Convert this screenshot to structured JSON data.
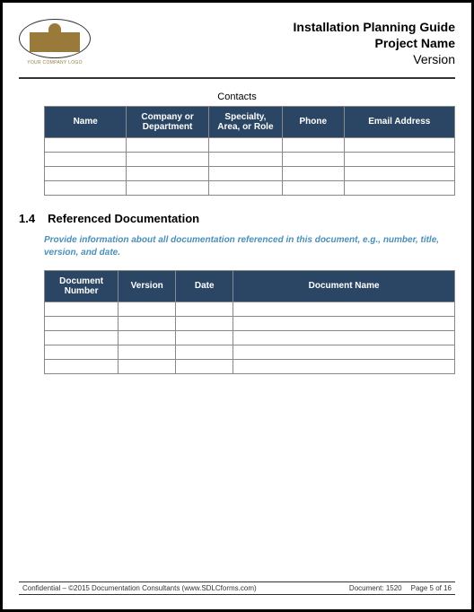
{
  "header": {
    "logo_caption": "YOUR COMPANY LOGO",
    "title1": "Installation Planning Guide",
    "title2": "Project Name",
    "title3": "Version"
  },
  "contacts": {
    "title": "Contacts",
    "headers": [
      "Name",
      "Company or Department",
      "Specialty, Area, or Role",
      "Phone",
      "Email Address"
    ],
    "rows": [
      [
        "",
        "",
        "",
        "",
        ""
      ],
      [
        "",
        "",
        "",
        "",
        ""
      ],
      [
        "",
        "",
        "",
        "",
        ""
      ],
      [
        "",
        "",
        "",
        "",
        ""
      ]
    ]
  },
  "section": {
    "number": "1.4",
    "title": "Referenced Documentation",
    "instruction": "Provide information about all documentation referenced in this document, e.g., number, title, version, and date."
  },
  "doc_table": {
    "headers": [
      "Document Number",
      "Version",
      "Date",
      "Document Name"
    ],
    "rows": [
      [
        "",
        "",
        "",
        ""
      ],
      [
        "",
        "",
        "",
        ""
      ],
      [
        "",
        "",
        "",
        ""
      ],
      [
        "",
        "",
        "",
        ""
      ],
      [
        "",
        "",
        "",
        ""
      ]
    ]
  },
  "footer": {
    "left": "Confidential – ©2015 Documentation Consultants (www.SDLCforms.com)",
    "center": "Document: 1520",
    "right": "Page 5 of 16"
  }
}
